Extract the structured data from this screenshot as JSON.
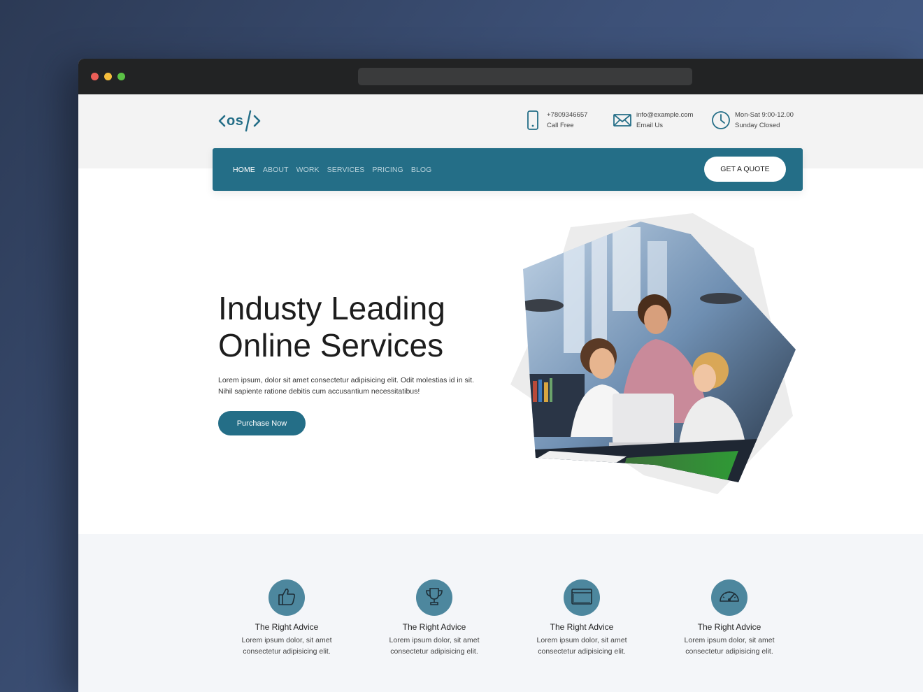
{
  "browser": {
    "url": ""
  },
  "header": {
    "logo": "<os/>",
    "phone": {
      "number": "+7809346657",
      "label": "Call Free",
      "icon": "phone-icon"
    },
    "email": {
      "address": "info@example.com",
      "label": "Email Us",
      "icon": "envelope-icon"
    },
    "hours": {
      "time": "Mon-Sat 9:00-12.00",
      "label": "Sunday Closed",
      "icon": "clock-icon"
    }
  },
  "nav": {
    "items": [
      "HOME",
      "ABOUT",
      "WORK",
      "SERVICES",
      "PRICING",
      "BLOG"
    ],
    "active": "HOME",
    "cta": "GET A QUOTE"
  },
  "hero": {
    "title_line1": "Industy Leading",
    "title_line2": "Online Services",
    "text_line1": "Lorem ipsum, dolor sit amet consectetur adipisicing elit. Odit molestias id in sit.",
    "text_line2": "Nihil sapiente ratione debitis cum accusantium necessitatibus!",
    "button": "Purchase Now"
  },
  "features": [
    {
      "icon": "thumbs-up-icon",
      "title": "The Right Advice",
      "desc_line1": "Lorem ipsum dolor, sit amet",
      "desc_line2": "consectetur adipisicing elit."
    },
    {
      "icon": "trophy-icon",
      "title": "The Right Advice",
      "desc_line1": "Lorem ipsum dolor, sit amet",
      "desc_line2": "consectetur adipisicing elit."
    },
    {
      "icon": "browser-window-icon",
      "title": "The Right Advice",
      "desc_line1": "Lorem ipsum dolor, sit amet",
      "desc_line2": "consectetur adipisicing elit."
    },
    {
      "icon": "speedometer-icon",
      "title": "The Right Advice",
      "desc_line1": "Lorem ipsum dolor, sit amet",
      "desc_line2": "consectetur adipisicing elit."
    }
  ],
  "colors": {
    "primary": "#246e87",
    "icon_circle": "#4d879e",
    "background": "#3d5178"
  }
}
